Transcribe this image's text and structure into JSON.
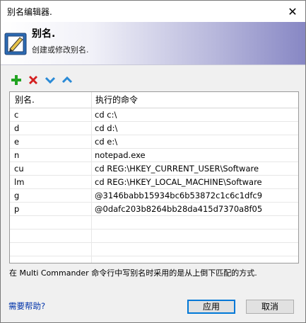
{
  "window": {
    "title": "别名编辑器."
  },
  "header": {
    "title": "别名.",
    "subtitle": "创建或修改别名."
  },
  "toolbar": {
    "icons": [
      "add-icon",
      "delete-icon",
      "move-down-icon",
      "move-up-icon"
    ]
  },
  "table": {
    "columns": [
      "别名.",
      "执行的命令"
    ],
    "rows": [
      [
        "c",
        "cd c:\\"
      ],
      [
        "d",
        "cd d:\\"
      ],
      [
        "e",
        "cd e:\\"
      ],
      [
        "n",
        "notepad.exe"
      ],
      [
        "cu",
        "cd REG:\\HKEY_CURRENT_USER\\Software"
      ],
      [
        "lm",
        "cd REG:\\HKEY_LOCAL_MACHINE\\Software"
      ],
      [
        "g",
        "@3146babb15934bc6b53872c1c6c1dfc9"
      ],
      [
        "p",
        "@0dafc203b8264bb28da415d7370a8f05"
      ]
    ],
    "empty_rows": 5
  },
  "info_text": "在 Multi Commander 命令行中写别名时采用的是从上倒下匹配的方式.",
  "help_link": "需要帮助?",
  "buttons": {
    "apply": "应用",
    "cancel": "取消"
  },
  "colors": {
    "add": "#21a321",
    "delete": "#d42020",
    "arrows": "#2a8ad6",
    "link": "#0033aa"
  }
}
